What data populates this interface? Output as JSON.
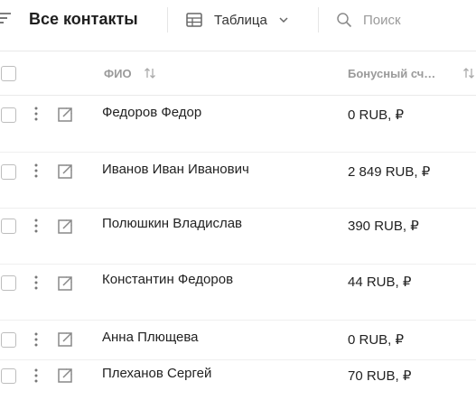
{
  "header": {
    "title": "Все контакты",
    "view": {
      "label": "Таблица",
      "icon": "table-icon"
    },
    "search": {
      "placeholder": "Поиск",
      "value": ""
    }
  },
  "table": {
    "columns": [
      {
        "label": "ФИО",
        "sortable": true
      },
      {
        "label": "Бонусный сч…",
        "sortable": true
      }
    ],
    "rows": [
      {
        "name": "Федоров Федор",
        "bonus": "0 RUB, ₽"
      },
      {
        "name": "Иванов Иван Иванович",
        "bonus": "2 849 RUB, ₽"
      },
      {
        "name": "Полюшкин Владислав",
        "bonus": "390 RUB, ₽"
      },
      {
        "name": "Константин Федоров",
        "bonus": "44 RUB, ₽"
      },
      {
        "name": "Анна Плющева",
        "bonus": "0 RUB, ₽"
      },
      {
        "name": "Плеханов Сергей",
        "bonus": "70 RUB, ₽"
      }
    ]
  },
  "colors": {
    "text": "#222222",
    "muted": "#9a9a9a",
    "border": "#e9e9e9",
    "icon": "#8a8a8a"
  }
}
